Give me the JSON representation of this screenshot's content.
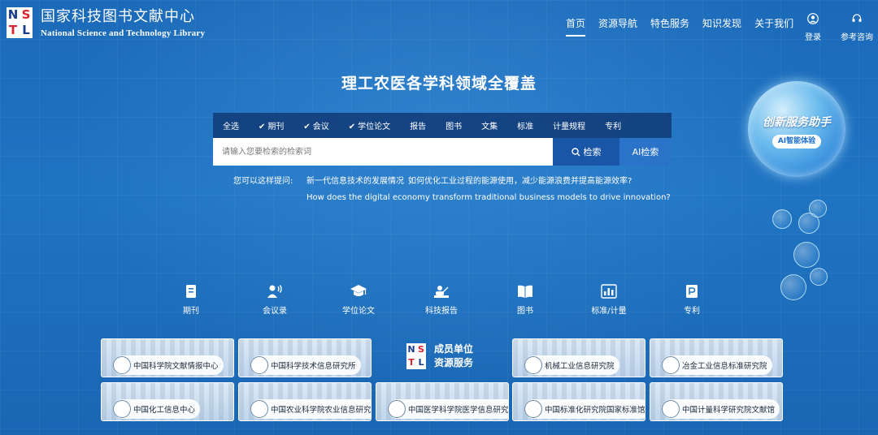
{
  "logo": {
    "mark": [
      "N",
      "S",
      "T",
      "L"
    ],
    "cn": "国家科技图书文献中心",
    "en": "National Science and Technology Library"
  },
  "nav": {
    "items": [
      {
        "label": "首页",
        "active": true
      },
      {
        "label": "资源导航"
      },
      {
        "label": "特色服务"
      },
      {
        "label": "知识发现"
      },
      {
        "label": "关于我们"
      }
    ],
    "login": "登录",
    "consult": "参考咨询"
  },
  "headline": "理工农医各学科领域全覆盖",
  "search": {
    "filters": [
      {
        "label": "全选",
        "checked": false
      },
      {
        "label": "期刊",
        "checked": true
      },
      {
        "label": "会议",
        "checked": true
      },
      {
        "label": "学位论文",
        "checked": true
      },
      {
        "label": "报告",
        "checked": false
      },
      {
        "label": "图书",
        "checked": false
      },
      {
        "label": "文集",
        "checked": false
      },
      {
        "label": "标准",
        "checked": false
      },
      {
        "label": "计量规程",
        "checked": false
      },
      {
        "label": "专利",
        "checked": false
      }
    ],
    "placeholder": "请输入您要检索的检索词",
    "search_button": "检索",
    "ai_button": "AI检索",
    "suggest_label": "您可以这样提问:",
    "suggestions": [
      "新一代信息技术的发展情况",
      "如何优化工业过程的能源使用，减少能源浪费并提高能源效率?",
      "How does the digital economy transform traditional business models to drive innovation?"
    ]
  },
  "assistant": {
    "title": "创新服务助手",
    "badge": "AI智能体验"
  },
  "categories": [
    "期刊",
    "会议录",
    "学位论文",
    "科技报告",
    "图书",
    "标准/计量",
    "专利"
  ],
  "members": {
    "title_line1": "成员单位",
    "title_line2": "资源服务",
    "row1": [
      "中国科学院文献情报中心",
      "中国科学技术信息研究所",
      "机械工业信息研究院",
      "冶金工业信息标准研究院"
    ],
    "row2": [
      "中国化工信息中心",
      "中国农业科学院农业信息研究所",
      "中国医学科学院医学信息研究所",
      "中国标准化研究院国家标准馆",
      "中国计量科学研究院文献馆"
    ]
  },
  "colors": {
    "background": "#1f74c2",
    "filter_bar": "#123a76",
    "search_button": "#1a56a8",
    "ai_button": "#2b73c9",
    "logo_red": "#d9232e",
    "logo_blue": "#1a3e8a"
  }
}
